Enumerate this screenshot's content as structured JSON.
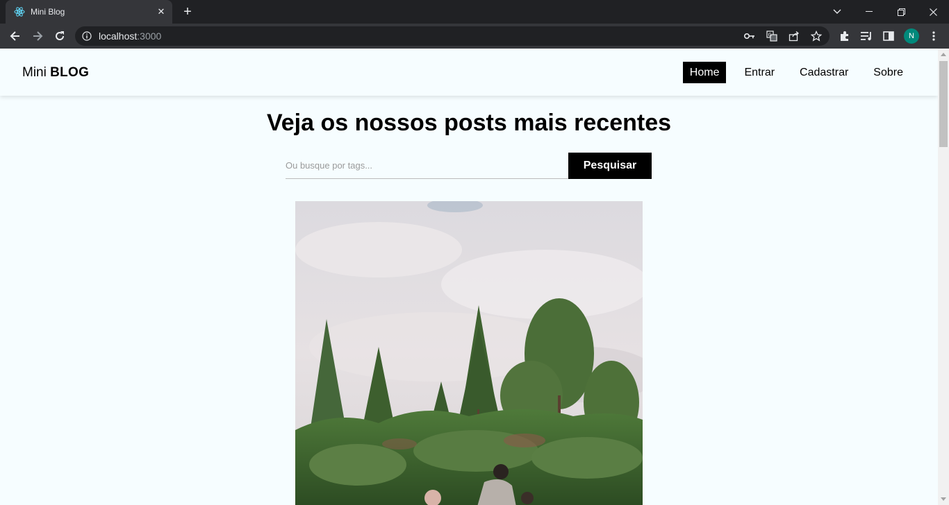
{
  "browser": {
    "tab_title": "Mini Blog",
    "tab_close": "✕",
    "new_tab": "+",
    "url_host": "localhost",
    "url_port": ":3000",
    "profile_initial": "N",
    "profile_color": "#00897b"
  },
  "site": {
    "brand_prefix": "Mini ",
    "brand_bold": "BLOG",
    "nav": [
      {
        "label": "Home",
        "active": true
      },
      {
        "label": "Entrar",
        "active": false
      },
      {
        "label": "Cadastrar",
        "active": false
      },
      {
        "label": "Sobre",
        "active": false
      }
    ]
  },
  "home": {
    "title": "Veja os nossos posts mais recentes",
    "search_placeholder": "Ou busque por tags...",
    "search_button": "Pesquisar"
  },
  "icons": {
    "favicon": "react-icon",
    "back": "arrow-left-icon",
    "forward": "arrow-right-icon",
    "reload": "reload-icon",
    "site_info": "info-icon",
    "password": "key-icon",
    "translate": "translate-icon",
    "share": "share-icon",
    "bookmark": "star-icon",
    "extensions": "puzzle-icon",
    "media": "playlist-icon",
    "side_panel": "side-panel-icon",
    "menu": "kebab-menu-icon"
  },
  "colors": {
    "page_background": "#f6fdff",
    "accent": "#000000"
  }
}
